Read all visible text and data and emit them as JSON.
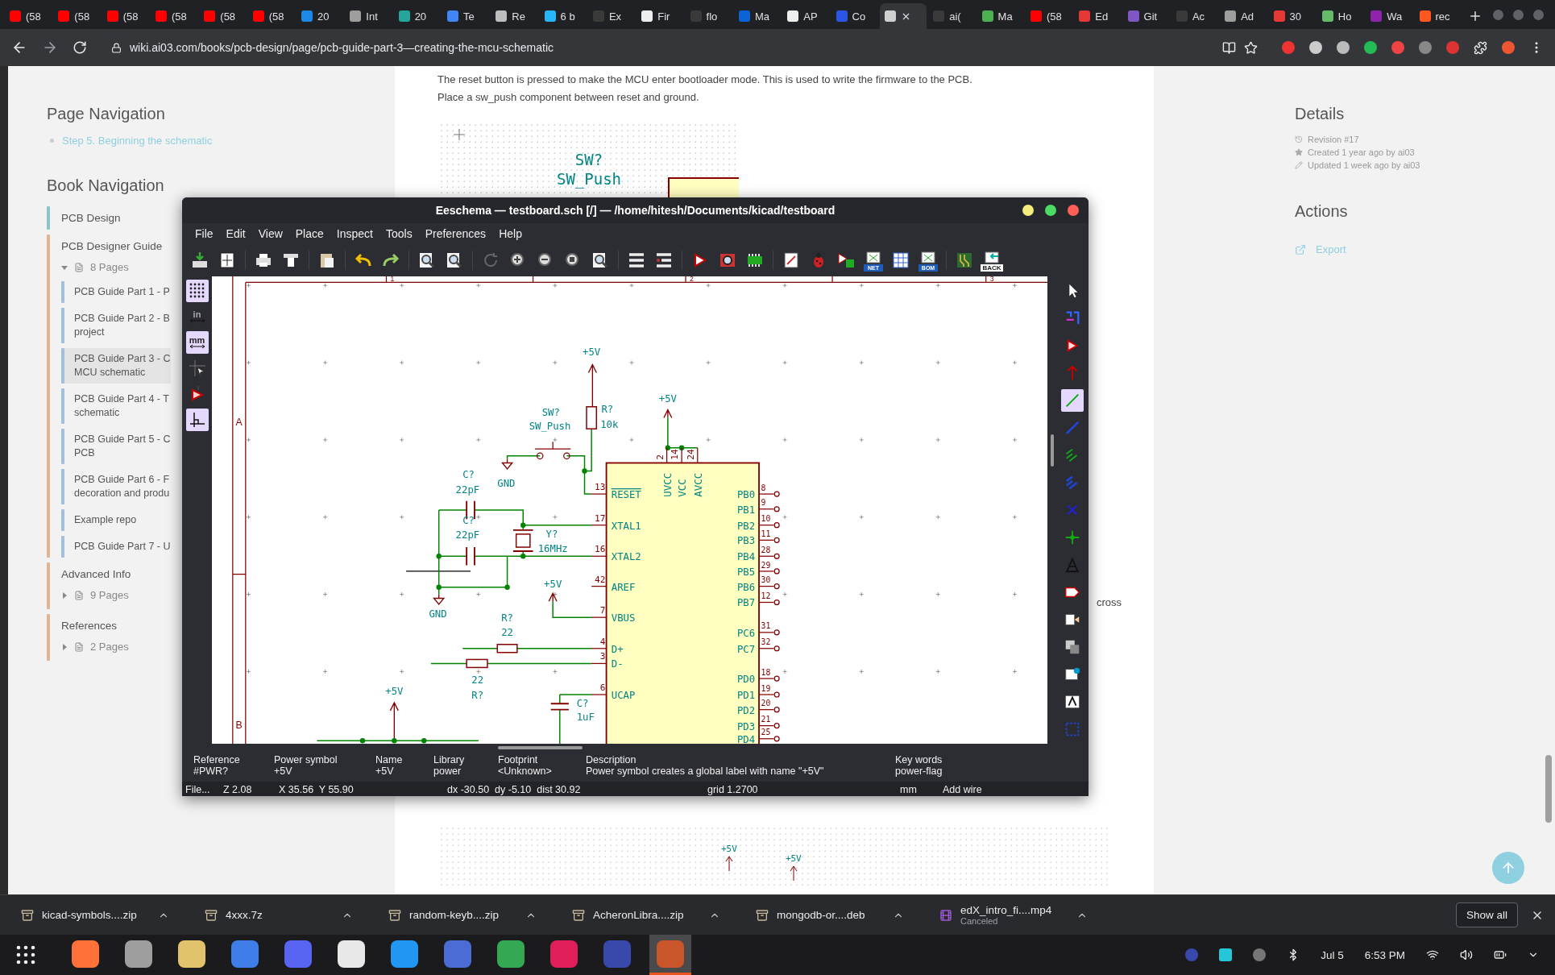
{
  "browser": {
    "tabs": [
      {
        "label": "(58",
        "color": "#ff0000",
        "selected": false
      },
      {
        "label": "(58",
        "color": "#ff0000",
        "selected": false
      },
      {
        "label": "(58",
        "color": "#ff0000",
        "selected": false
      },
      {
        "label": "(58",
        "color": "#ff0000",
        "selected": false
      },
      {
        "label": "(58",
        "color": "#ff0000",
        "selected": false
      },
      {
        "label": "(58",
        "color": "#ff0000",
        "selected": false
      },
      {
        "label": "20",
        "color": "#1e88e5",
        "selected": false
      },
      {
        "label": "Int",
        "color": "#9e9e9e",
        "selected": false
      },
      {
        "label": "20",
        "color": "#26a69a",
        "selected": false
      },
      {
        "label": "Te",
        "color": "#4285f4",
        "selected": false
      },
      {
        "label": "Re",
        "color": "#bdbdbd",
        "selected": false
      },
      {
        "label": "6 b",
        "color": "#29b6f6",
        "selected": false
      },
      {
        "label": "Ex",
        "color": "#3a3a3a",
        "selected": false
      },
      {
        "label": "Fir",
        "color": "#eeeeee",
        "selected": false
      },
      {
        "label": "flo",
        "color": "#3a3a3a",
        "selected": false
      },
      {
        "label": "Ma",
        "color": "#0a64d8",
        "selected": false
      },
      {
        "label": "AP",
        "color": "#eeeeee",
        "selected": false
      },
      {
        "label": "Co",
        "color": "#2a55e5",
        "selected": false
      },
      {
        "color": "#d0d0d0",
        "selected": true
      },
      {
        "label": "ai(",
        "color": "#3a3a3a",
        "selected": false
      },
      {
        "label": "Ma",
        "color": "#4caf50",
        "selected": false
      },
      {
        "label": "(58",
        "color": "#ff0000",
        "selected": false
      },
      {
        "label": "Ed",
        "color": "#e53935",
        "selected": false
      },
      {
        "label": "Git",
        "color": "#7e57c2",
        "selected": false
      },
      {
        "label": "Ac",
        "color": "#3a3a3a",
        "selected": false
      },
      {
        "label": "Ad",
        "color": "#9e9e9e",
        "selected": false
      },
      {
        "label": "30",
        "color": "#e53935",
        "selected": false
      },
      {
        "label": "Ho",
        "color": "#66bb6a",
        "selected": false
      },
      {
        "label": "Wa",
        "color": "#8e24aa",
        "selected": false
      },
      {
        "label": "rec",
        "color": "#ff5722",
        "selected": false
      }
    ],
    "url": "wiki.ai03.com/books/pcb-design/page/pcb-guide-part-3—creating-the-mcu-schematic"
  },
  "sidebar": {
    "page_navigation": {
      "title": "Page Navigation",
      "links": [
        "Step 5. Beginning the schematic"
      ]
    },
    "book_navigation": {
      "title": "Book Navigation",
      "items": [
        {
          "kind": "book",
          "title": "PCB Design"
        },
        {
          "kind": "chapter",
          "title": "PCB Designer Guide",
          "expanded": true,
          "count": "8 Pages",
          "pages": [
            {
              "lines": [
                "PCB Guide Part 1 - P"
              ],
              "selected": false
            },
            {
              "lines": [
                "PCB Guide Part 2 - B",
                "project"
              ],
              "selected": false
            },
            {
              "lines": [
                "PCB Guide Part 3 - C",
                "MCU schematic"
              ],
              "selected": true
            },
            {
              "lines": [
                "PCB Guide Part 4 - T",
                "schematic"
              ],
              "selected": false
            },
            {
              "lines": [
                "PCB Guide Part 5 - C",
                "PCB"
              ],
              "selected": false
            },
            {
              "lines": [
                "PCB Guide Part 6 - F",
                "decoration and produ"
              ],
              "selected": false
            },
            {
              "lines": [
                "Example repo"
              ],
              "selected": false
            },
            {
              "lines": [
                "PCB Guide Part 7 - U"
              ],
              "selected": false
            }
          ]
        },
        {
          "kind": "chapter",
          "title": "Advanced Info",
          "expanded": false,
          "count": "9 Pages"
        },
        {
          "kind": "chapter",
          "title": "References",
          "expanded": false,
          "count": "2 Pages"
        }
      ]
    }
  },
  "article": {
    "paragraph": [
      "The reset button is pressed to make the MCU enter bootloader mode. This is used to write the firmware to the PCB.",
      "Place a sw_push component between reset and ground."
    ],
    "figure_top": {
      "labels": [
        "SW?",
        "SW_Push"
      ]
    },
    "covered_text": "cross",
    "figure_bottom": {
      "labels": [
        "+5V",
        "+5V"
      ]
    }
  },
  "details": {
    "title": "Details",
    "items": [
      {
        "kind": "revision",
        "text": "Revision #17"
      },
      {
        "kind": "created",
        "text": "Created 1 year ago by ai03"
      },
      {
        "kind": "updated",
        "text": "Updated 1 week ago by ai03"
      }
    ],
    "actions_title": "Actions",
    "actions": [
      "Export"
    ]
  },
  "eeschema": {
    "title": "Eeschema — testboard.sch [/] — /home/hitesh/Documents/kicad/testboard",
    "menu": [
      "File",
      "Edit",
      "View",
      "Place",
      "Inspect",
      "Tools",
      "Preferences",
      "Help"
    ],
    "toolbar": [
      {
        "kind": "save"
      },
      {
        "kind": "page"
      },
      {
        "kind": "sep"
      },
      {
        "kind": "print"
      },
      {
        "kind": "plot"
      },
      {
        "kind": "sep"
      },
      {
        "kind": "paste"
      },
      {
        "kind": "sep"
      },
      {
        "kind": "undo"
      },
      {
        "kind": "redo"
      },
      {
        "kind": "sep"
      },
      {
        "kind": "find"
      },
      {
        "kind": "replace"
      },
      {
        "kind": "sep"
      },
      {
        "kind": "refresh"
      },
      {
        "kind": "zoomin"
      },
      {
        "kind": "zoomout"
      },
      {
        "kind": "zoomfit"
      },
      {
        "kind": "zoomsel"
      },
      {
        "kind": "sep"
      },
      {
        "kind": "hierarchy"
      },
      {
        "kind": "leave"
      },
      {
        "kind": "sep"
      },
      {
        "kind": "symbol"
      },
      {
        "kind": "libbrowse"
      },
      {
        "kind": "chip"
      },
      {
        "kind": "sep"
      },
      {
        "kind": "annotate"
      },
      {
        "kind": "bug"
      },
      {
        "kind": "assign"
      },
      {
        "kind": "badge",
        "label": "NET"
      },
      {
        "kind": "table"
      },
      {
        "kind": "badge",
        "label": "BOM"
      },
      {
        "kind": "sep"
      },
      {
        "kind": "pcb"
      },
      {
        "kind": "badge",
        "label": "BACK"
      }
    ],
    "left_tools": [
      {
        "kind": "grid",
        "on": true
      },
      {
        "kind": "unit",
        "label": "in",
        "selected": false
      },
      {
        "kind": "unit",
        "label": "mm",
        "selected": true
      },
      {
        "kind": "cursor",
        "on": false
      },
      {
        "kind": "pin",
        "on": false
      },
      {
        "kind": "angle",
        "on": true
      }
    ],
    "right_tools": [
      {
        "kind": "select",
        "on": false
      },
      {
        "kind": "highlight",
        "on": false
      },
      {
        "kind": "symbol",
        "on": false
      },
      {
        "kind": "power",
        "on": false
      },
      {
        "kind": "wire",
        "on": true
      },
      {
        "kind": "bus",
        "on": false
      },
      {
        "kind": "entry",
        "on": false
      },
      {
        "kind": "busentry",
        "on": false
      },
      {
        "kind": "noconnect",
        "on": false
      },
      {
        "kind": "junction",
        "on": false
      },
      {
        "kind": "label",
        "on": false
      },
      {
        "kind": "glabel",
        "on": false
      },
      {
        "kind": "hlabel",
        "on": false
      },
      {
        "kind": "sheet",
        "on": false
      },
      {
        "kind": "import",
        "on": false
      },
      {
        "kind": "text",
        "on": false
      },
      {
        "kind": "lines",
        "on": false
      }
    ],
    "schematic": {
      "sheet_columns": [
        "1",
        "2",
        "3"
      ],
      "sheet_rows": [
        "A",
        "B"
      ],
      "labels": [
        "+5V",
        "SW?",
        "SW_Push",
        "R?",
        "10k",
        "+5V",
        "C?",
        "22pF",
        "GND",
        "C?",
        "22pF",
        "Y?",
        "16MHz",
        "+5V",
        "GND",
        "R?",
        "22",
        "22",
        "R?",
        "+5V",
        "C?",
        "1uF"
      ],
      "left_pins": [
        {
          "name": "RESET",
          "number": "13",
          "inverted": true
        },
        {
          "name": "XTAL1",
          "number": "17",
          "inverted": false
        },
        {
          "name": "XTAL2",
          "number": "16",
          "inverted": false
        },
        {
          "name": "AREF",
          "number": "42",
          "inverted": false
        },
        {
          "name": "VBUS",
          "number": "7",
          "inverted": false
        },
        {
          "name": "D+",
          "number": "4",
          "inverted": false
        },
        {
          "name": "D-",
          "number": "3",
          "inverted": false
        },
        {
          "name": "UCAP",
          "number": "6",
          "inverted": false
        }
      ],
      "top_pins": [
        {
          "name": "UVCC",
          "number": "2"
        },
        {
          "name": "VCC",
          "number": "14"
        },
        {
          "name": "AVCC",
          "number": "24"
        }
      ],
      "right_pins": [
        {
          "name": "PB0",
          "number": "8"
        },
        {
          "name": "PB1",
          "number": "9"
        },
        {
          "name": "PB2",
          "number": "10"
        },
        {
          "name": "PB3",
          "number": "11"
        },
        {
          "name": "PB4",
          "number": "28"
        },
        {
          "name": "PB5",
          "number": "29"
        },
        {
          "name": "PB6",
          "number": "30"
        },
        {
          "name": "PB7",
          "number": "12"
        },
        {
          "name": "PC6",
          "number": "31"
        },
        {
          "name": "PC7",
          "number": "32"
        },
        {
          "name": "PD0",
          "number": "18"
        },
        {
          "name": "PD1",
          "number": "19"
        },
        {
          "name": "PD2",
          "number": "20"
        },
        {
          "name": "PD3",
          "number": "21"
        },
        {
          "name": "PD4",
          "number": "25"
        }
      ]
    },
    "properties": [
      {
        "label": "Reference",
        "value": "#PWR?"
      },
      {
        "label": "Power symbol",
        "value": "+5V"
      },
      {
        "label": "Name",
        "value": "+5V"
      },
      {
        "label": "Library",
        "value": "power"
      },
      {
        "label": "Footprint",
        "value": "<Unknown>"
      },
      {
        "label": "Description",
        "value": "Power symbol creates a global label with name \"+5V\""
      },
      {
        "label": "Key words",
        "value": "power-flag"
      }
    ],
    "status": [
      "File...",
      "Z 2.08",
      "X 35.56  Y 55.90",
      "dx -30.50  dy -5.10  dist 30.92",
      "grid 1.2700",
      "mm",
      "Add wire"
    ]
  },
  "downloads": {
    "items": [
      {
        "kind": "archive",
        "name": "kicad-symbols....zip"
      },
      {
        "kind": "archive",
        "name": "4xxx.7z"
      },
      {
        "kind": "archive",
        "name": "random-keyb....zip"
      },
      {
        "kind": "archive",
        "name": "AcheronLibra....zip"
      },
      {
        "kind": "archive",
        "name": "mongodb-or....deb"
      },
      {
        "kind": "video",
        "name": "edX_intro_fi....mp4",
        "note": "Canceled"
      }
    ],
    "show_all": "Show all"
  },
  "taskbar": {
    "apps": [
      {
        "color": "#ff7139",
        "active": false
      },
      {
        "color": "#9e9e9e",
        "active": false
      },
      {
        "color": "#e0c36a",
        "active": false
      },
      {
        "color": "#3f7ee8",
        "active": false
      },
      {
        "color": "#5865f2",
        "active": false
      },
      {
        "color": "#e8e8e8",
        "active": false
      },
      {
        "color": "#2196f3",
        "active": false
      },
      {
        "color": "#4a6cd4",
        "active": false
      },
      {
        "color": "#34a853",
        "active": false
      },
      {
        "color": "#e01e5a",
        "active": false
      },
      {
        "color": "#3949ab",
        "active": false
      },
      {
        "color": "#c9562a",
        "active": true
      }
    ],
    "date": "Jul 5",
    "time": "6:53 PM"
  }
}
